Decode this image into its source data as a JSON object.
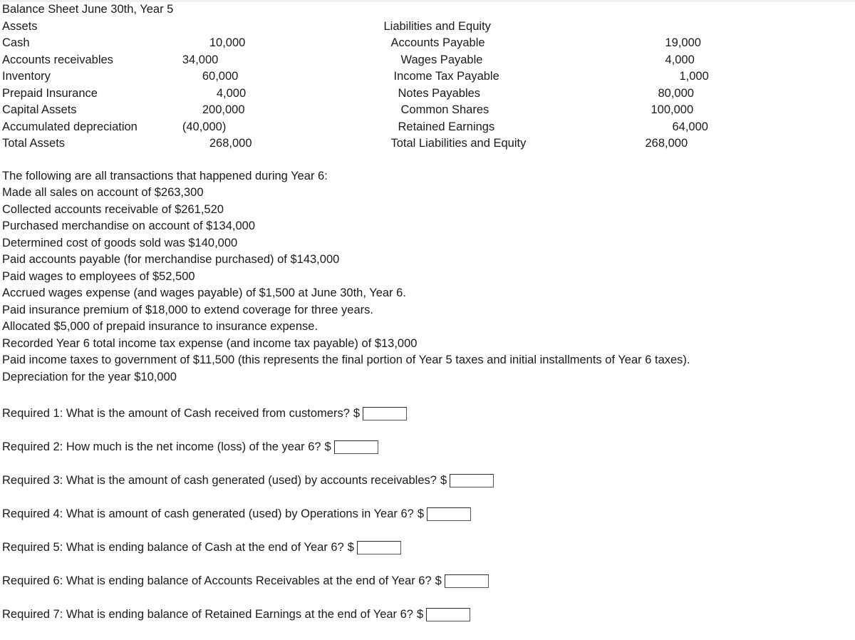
{
  "balance_sheet": {
    "title": "Balance Sheet June 30th, Year 5",
    "left_header": "Assets",
    "right_header": "Liabilities and Equity",
    "left_rows": [
      {
        "label": "Cash",
        "value": "10,000"
      },
      {
        "label": "Accounts receivables",
        "value": "34,000"
      },
      {
        "label": "Inventory",
        "value": "60,000"
      },
      {
        "label": "Prepaid Insurance",
        "value": "4,000"
      },
      {
        "label": "Capital Assets",
        "value": "200,000"
      },
      {
        "label": "Accumulated depreciation",
        "value": "(40,000)"
      },
      {
        "label": "Total Assets",
        "value": "268,000"
      }
    ],
    "right_rows": [
      {
        "label": "Accounts Payable",
        "value": "19,000"
      },
      {
        "label": "Wages Payable",
        "value": "4,000"
      },
      {
        "label": "Income Tax Payable",
        "value": "1,000"
      },
      {
        "label": "Notes Payables",
        "value": "80,000"
      },
      {
        "label": "Common Shares",
        "value": "100,000"
      },
      {
        "label": "Retained Earnings",
        "value": "64,000"
      },
      {
        "label": "Total Liabilities and Equity",
        "value": "268,000"
      }
    ]
  },
  "transactions": {
    "intro": "The following are all transactions that happened during Year 6:",
    "items": [
      "Made all sales on account of $263,300",
      "Collected accounts receivable of $261,520",
      "Purchased merchandise on account of $134,000",
      "Determined cost of goods sold was $140,000",
      "Paid accounts payable (for merchandise purchased) of $143,000",
      "Paid wages to employees of $52,500",
      "Accrued wages expense (and wages payable) of $1,500 at June 30th, Year 6.",
      "Paid insurance premium of $18,000 to extend coverage for three years.",
      "Allocated $5,000 of prepaid insurance to insurance expense.",
      "Recorded Year 6 total income tax expense (and income tax payable) of $13,000",
      "Paid income taxes to government of $11,500 (this represents the final portion of Year 5 taxes and initial installments of Year 6 taxes).",
      "Depreciation for the year $10,000"
    ]
  },
  "requirements": {
    "dollar_sign": "$",
    "answer_placeholder": "",
    "items": [
      {
        "label": "Required 1: What is the amount of Cash received from customers?",
        "answer": ""
      },
      {
        "label": "Required 2: How much is the net income (loss) of the year 6?",
        "answer": ""
      },
      {
        "label": "Required 3: What is the amount of cash generated (used) by accounts receivables?",
        "answer": ""
      },
      {
        "label": "Required 4: What is amount of cash generated (used) by Operations in Year 6?",
        "answer": ""
      },
      {
        "label": "Required 5: What is ending balance of Cash at the end of Year 6?",
        "answer": ""
      },
      {
        "label": "Required 6: What is ending balance of Accounts Receivables at the end of Year 6?",
        "answer": ""
      },
      {
        "label": "Required 7: What is ending balance of Retained Earnings at the end of Year 6?",
        "answer": ""
      }
    ]
  },
  "colors": {
    "text": "#1a1a1a",
    "background": "#ffffff",
    "box_border": "#2b2b2b",
    "top_edge": "#f0f0f2"
  }
}
